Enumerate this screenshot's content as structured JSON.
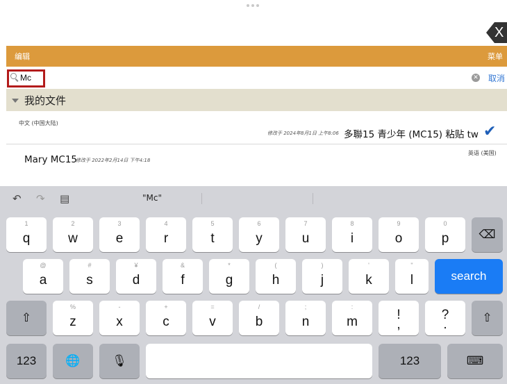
{
  "top": {
    "close_label": "X"
  },
  "edit_bar": {
    "left_label": "编辑",
    "right_label": "菜单"
  },
  "search": {
    "value": "Mc",
    "placeholder": "",
    "clear_icon": "clear-circle-icon",
    "cancel_label": "取消"
  },
  "folder": {
    "title": "我的文件",
    "icon": "disclosure-triangle-icon"
  },
  "files": [
    {
      "lang": "中文 (中国大陆)",
      "modified": "修改于 2024年8月1日 上午8:06",
      "name": "多聯15 青少年 (MC15) 粘贴 tw",
      "selected": true
    },
    {
      "name": "Mary MC15",
      "modified": "修改于 2022年2月14日 下午4:18",
      "lang": "英语 (美国)",
      "selected": false
    }
  ],
  "keyboard": {
    "suggestion": "\"Mc\"",
    "row1": [
      {
        "hint": "1",
        "key": "q"
      },
      {
        "hint": "2",
        "key": "w"
      },
      {
        "hint": "3",
        "key": "e"
      },
      {
        "hint": "4",
        "key": "r"
      },
      {
        "hint": "5",
        "key": "t"
      },
      {
        "hint": "6",
        "key": "y"
      },
      {
        "hint": "7",
        "key": "u"
      },
      {
        "hint": "8",
        "key": "i"
      },
      {
        "hint": "9",
        "key": "o"
      },
      {
        "hint": "0",
        "key": "p"
      }
    ],
    "row2": [
      {
        "hint": "@",
        "key": "a"
      },
      {
        "hint": "#",
        "key": "s"
      },
      {
        "hint": "¥",
        "key": "d"
      },
      {
        "hint": "&",
        "key": "f"
      },
      {
        "hint": "*",
        "key": "g"
      },
      {
        "hint": "(",
        "key": "h"
      },
      {
        "hint": ")",
        "key": "j"
      },
      {
        "hint": "'",
        "key": "k"
      },
      {
        "hint": "\"",
        "key": "l"
      }
    ],
    "row3": [
      {
        "hint": "%",
        "key": "z"
      },
      {
        "hint": "-",
        "key": "x"
      },
      {
        "hint": "+",
        "key": "c"
      },
      {
        "hint": "=",
        "key": "v"
      },
      {
        "hint": "/",
        "key": "b"
      },
      {
        "hint": ";",
        "key": "n"
      },
      {
        "hint": ":",
        "key": "m"
      },
      {
        "hint": "!",
        "key": "!"
      },
      {
        "hint": "?",
        "key": "?"
      }
    ],
    "search_label": "search",
    "numbers_label": "123"
  },
  "colors": {
    "accent_orange": "#dc9a3c",
    "folder_bg": "#e3dfce",
    "search_key": "#1a7cf5",
    "highlight_border": "#b31b1b"
  }
}
